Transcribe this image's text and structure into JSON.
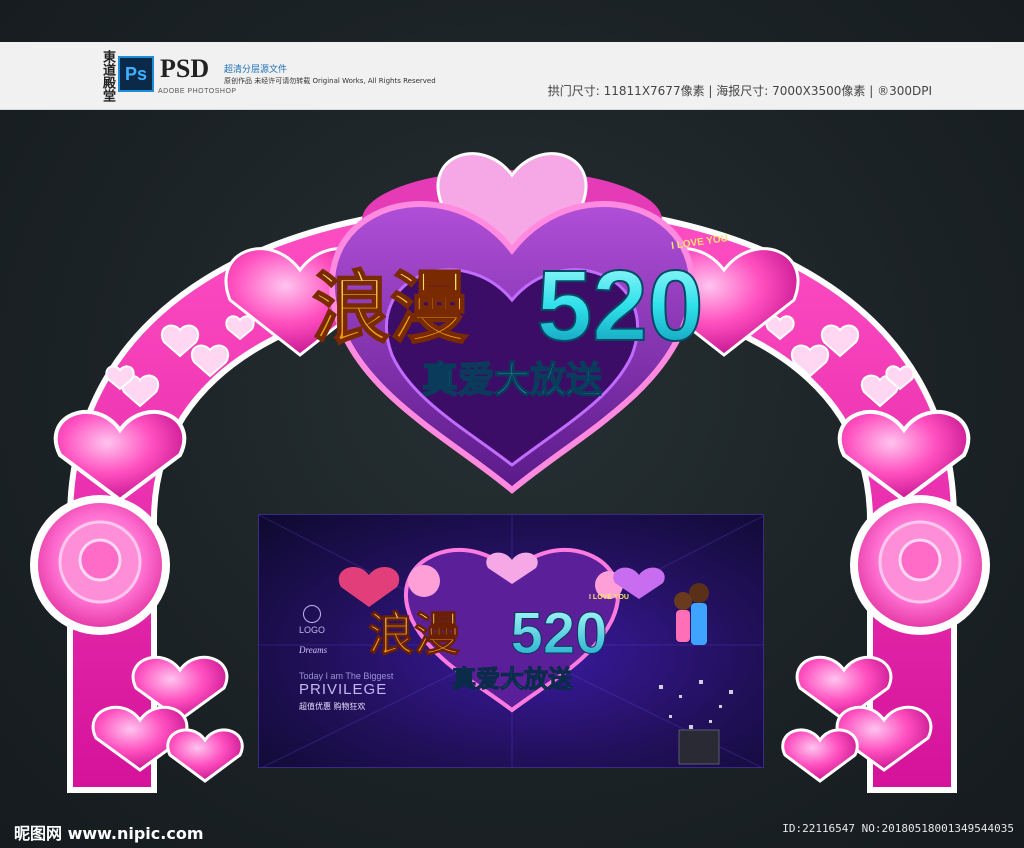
{
  "header": {
    "brand_mark": "東道殿堂",
    "ps_badge": "Ps",
    "psd_label": "PSD",
    "adobe_line": "ADOBE PHOTOSHOP",
    "desc_cn": "超清分层源文件",
    "desc_sub": "原创作品  未经许可请勿转载 Original Works, All Rights Reserved",
    "spec_line": "拱门尺寸: 11811X7677像素 | 海报尺寸: 7000X3500像素 | ®300DPI"
  },
  "arch": {
    "title_cn": "浪漫",
    "title_num": "520",
    "i_love_you": "I LOVE YOU",
    "subtitle": "真爱大放送"
  },
  "banner": {
    "logo": "LOGO",
    "dreams": "Dreams",
    "tagline": "Today I am The Biggest",
    "privilege": "PRIVILEGE",
    "small_text": "超值优惠 购物狂欢",
    "title_cn": "浪漫",
    "title_num": "520",
    "i_love_you": "I LOVE YOU",
    "subtitle": "真爱大放送"
  },
  "footer": {
    "watermark": "昵图网 www.nipic.com",
    "image_id": "ID:22116547 NO:20180518001349544035"
  },
  "colors": {
    "magenta": "#e21ea8",
    "pink_light": "#ff7ad0",
    "gold": "#f8c22c",
    "cyan": "#2fe0ea",
    "bg": "#1c2428",
    "banner_bg": "#21105a"
  }
}
